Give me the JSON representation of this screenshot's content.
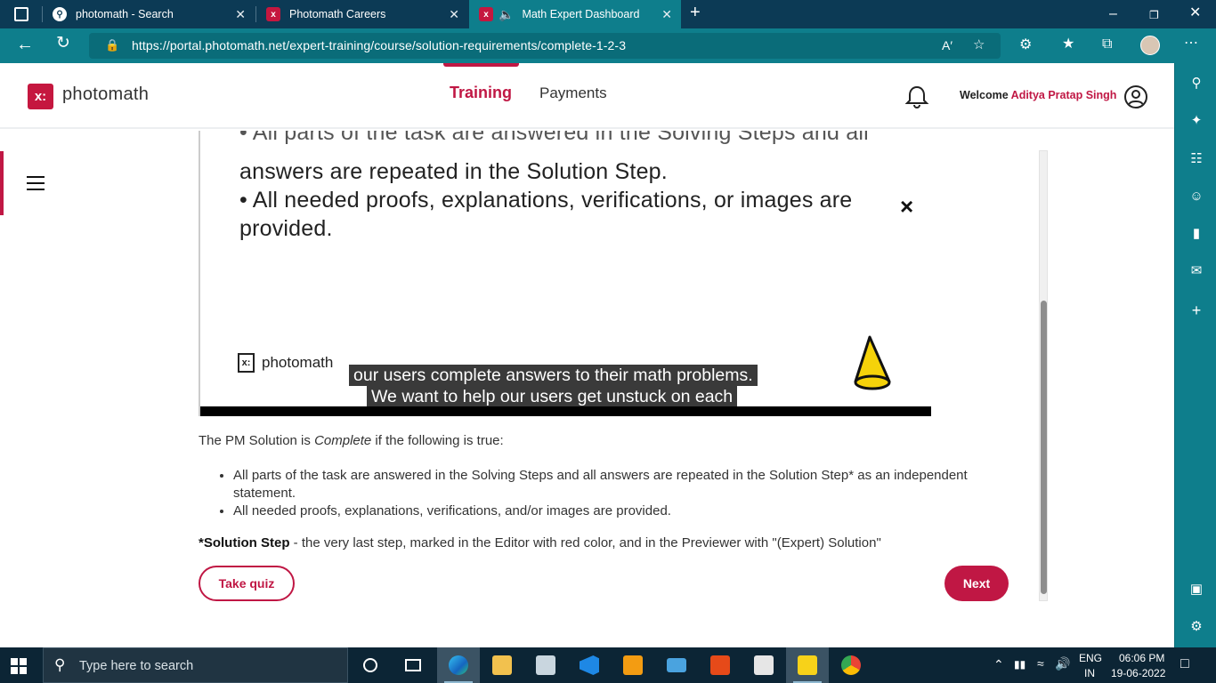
{
  "browser": {
    "tabs": [
      {
        "title": "photomath - Search",
        "icon": "search-icon"
      },
      {
        "title": "Photomath Careers",
        "icon": "photomath-icon"
      },
      {
        "title": "Math Expert Dashboard",
        "icon": "photomath-icon",
        "active": true,
        "audio": true
      }
    ],
    "url": "https://portal.photomath.net/expert-training/course/solution-requirements/complete-1-2-3"
  },
  "header": {
    "logo_text": "photomath",
    "nav": {
      "training": "Training",
      "payments": "Payments"
    },
    "welcome_prefix": "Welcome",
    "user_name": "Aditya Pratap Singh",
    "accent": "#c01744"
  },
  "video": {
    "slide_line_top": "• All parts of the task are answered in the Solving Steps and all",
    "slide_line_1": "answers are repeated in the Solution Step.",
    "slide_line_2": "• All needed proofs, explanations, verifications, or images are",
    "slide_line_3": "provided.",
    "close_glyph": "×",
    "logo_text": "photomath",
    "caption_1": "our users complete answers to their math problems.",
    "caption_2": "We want to help our users get unstuck on each"
  },
  "lesson": {
    "intro_before": "The PM Solution is ",
    "intro_em": "Complete",
    "intro_after": " if the following is true:",
    "bullets": [
      "All parts of the task are answered in the Solving Steps and all answers are repeated in the Solution Step* as an independent statement.",
      "All needed proofs, explanations, verifications, and/or images are provided."
    ],
    "solution_term": "*Solution Step",
    "solution_def": " - the very last step, marked in the Editor with red color, and in the Previewer with \"(Expert) Solution\""
  },
  "buttons": {
    "take_quiz": "Take quiz",
    "next": "Next"
  },
  "taskbar": {
    "search_placeholder": "Type here to search",
    "language": "ENG",
    "region": "IN",
    "time": "06:06 PM",
    "date": "19-06-2022"
  }
}
